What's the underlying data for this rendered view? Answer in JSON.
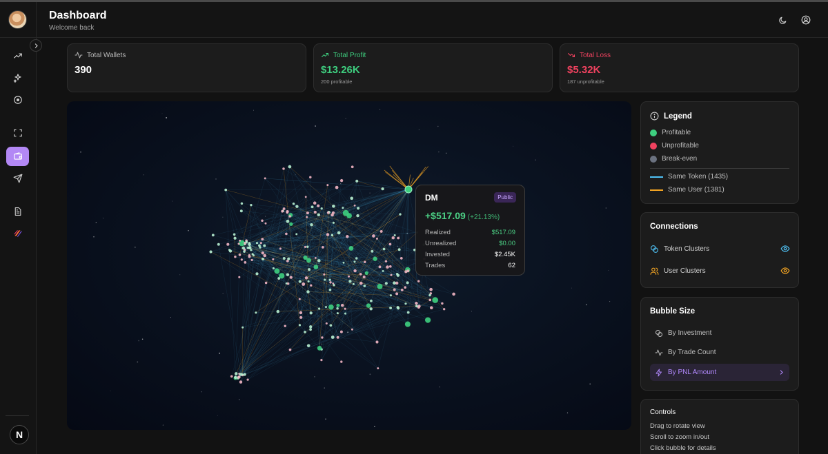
{
  "header": {
    "title": "Dashboard",
    "subtitle": "Welcome back",
    "theme_icon": "moon-icon",
    "account_icon": "user-circle-icon"
  },
  "sidebar": {
    "items": [
      {
        "name": "trending-icon"
      },
      {
        "name": "sparkles-icon"
      },
      {
        "name": "target-icon"
      },
      {
        "name": "scan-icon"
      },
      {
        "name": "wallet-icon",
        "active": true
      },
      {
        "name": "send-icon"
      },
      {
        "name": "document-icon"
      },
      {
        "name": "chain-logo-icon"
      }
    ],
    "logo": "N"
  },
  "stats": {
    "wallets": {
      "label": "Total Wallets",
      "value": "390",
      "note": ""
    },
    "profit": {
      "label": "Total Profit",
      "value": "$13.26K",
      "note": "200 profitable"
    },
    "loss": {
      "label": "Total Loss",
      "value": "$5.32K",
      "note": "187 unprofitable"
    }
  },
  "tooltip": {
    "name": "DM",
    "badge": "Public",
    "pnl": "+$517.09",
    "pnl_pct": "(+21.13%)",
    "rows": [
      {
        "label": "Realized",
        "value": "$517.09"
      },
      {
        "label": "Unrealized",
        "value": "$0.00"
      },
      {
        "label": "Invested",
        "value": "$2.45K"
      },
      {
        "label": "Trades",
        "value": "62"
      }
    ]
  },
  "legend": {
    "title": "Legend",
    "items": [
      {
        "label": "Profitable",
        "color": "#3ecf7f"
      },
      {
        "label": "Unprofitable",
        "color": "#f0425f"
      },
      {
        "label": "Break-even",
        "color": "#6b7280"
      }
    ],
    "lines": [
      {
        "label": "Same Token (1435)",
        "color": "#4fc3f7"
      },
      {
        "label": "Same User (1381)",
        "color": "#f5a623"
      }
    ]
  },
  "connections": {
    "title": "Connections",
    "items": [
      {
        "label": "Token Clusters",
        "color": "#4fc3f7"
      },
      {
        "label": "User Clusters",
        "color": "#f5a623"
      }
    ]
  },
  "bubble_size": {
    "title": "Bubble Size",
    "options": [
      "By Investment",
      "By Trade Count",
      "By PNL Amount"
    ],
    "selected": "By PNL Amount"
  },
  "controls": {
    "title": "Controls",
    "lines": [
      "Drag to rotate view",
      "Scroll to zoom in/out",
      "Click bubble for details"
    ]
  },
  "colors": {
    "accent": "#b388f5",
    "profit": "#3ecf7f",
    "loss": "#f0425f"
  }
}
